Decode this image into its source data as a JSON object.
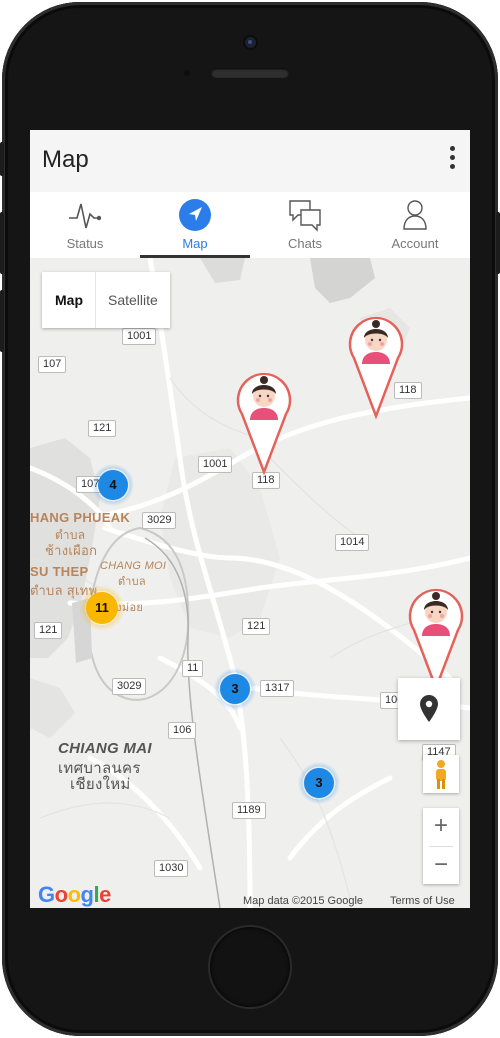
{
  "app": {
    "title": "Map"
  },
  "tabs": [
    {
      "label": "Status",
      "icon": "pulse-icon",
      "active": false
    },
    {
      "label": "Map",
      "icon": "navigation-icon",
      "active": true
    },
    {
      "label": "Chats",
      "icon": "chat-bubbles-icon",
      "active": false
    },
    {
      "label": "Account",
      "icon": "person-icon",
      "active": false
    }
  ],
  "map": {
    "type_toggle": {
      "map_label": "Map",
      "satellite_label": "Satellite",
      "selected": "Map"
    },
    "road_shields": [
      "1001",
      "107",
      "121",
      "1001",
      "118",
      "118",
      "107",
      "3029",
      "1014",
      "121",
      "121",
      "11",
      "1317",
      "3029",
      "106",
      "106",
      "1147",
      "1189",
      "1030"
    ],
    "places": [
      "HANG PHUEAK",
      "ตำบล",
      "ช้างเผือก",
      "SU THEP",
      "ตำบล สุเทพ",
      "CHANG MOI",
      "ตำบล",
      "ช้างม่อย",
      "CHIANG MAI",
      "เทศบาลนคร",
      "เชียงใหม่"
    ],
    "clusters": [
      {
        "count": "4",
        "color": "#1e88e5"
      },
      {
        "count": "11",
        "color": "#f9b700"
      },
      {
        "count": "3",
        "color": "#1e88e5"
      },
      {
        "count": "3",
        "color": "#1e88e5"
      }
    ],
    "markers": [
      "avatar-pin",
      "avatar-pin",
      "avatar-pin"
    ],
    "attribution": {
      "logo": "Google",
      "data": "Map data ©2015 Google",
      "terms": "Terms of Use"
    },
    "controls": {
      "zoom_in": "+",
      "zoom_out": "−"
    }
  },
  "colors": {
    "accent": "#2b7de9",
    "pin": "#e5625a",
    "avatar_shirt": "#e8507a"
  }
}
